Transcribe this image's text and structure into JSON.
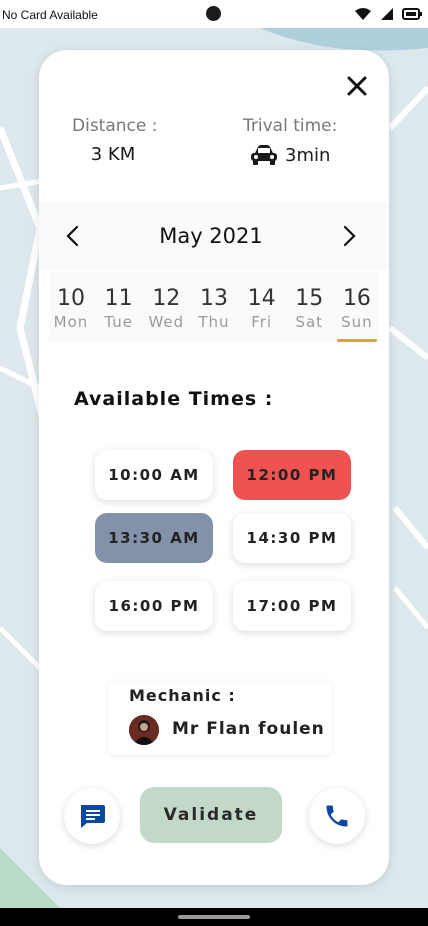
{
  "status_bar": {
    "carrier": "No Card Available"
  },
  "header": {
    "distance_label": "Distance :",
    "distance_value": "3 KM",
    "travel_label": "Trival time:",
    "travel_value": "3min"
  },
  "calendar": {
    "month": "May 2021",
    "days": [
      {
        "num": "10",
        "name": "Mon"
      },
      {
        "num": "11",
        "name": "Tue"
      },
      {
        "num": "12",
        "name": "Wed"
      },
      {
        "num": "13",
        "name": "Thu"
      },
      {
        "num": "14",
        "name": "Fri"
      },
      {
        "num": "15",
        "name": "Sat"
      },
      {
        "num": "16",
        "name": "Sun"
      }
    ],
    "selected_day": "16"
  },
  "times": {
    "title": "Available Times :",
    "slots": [
      {
        "label": "10:00 AM",
        "state": "default"
      },
      {
        "label": "12:00 PM",
        "state": "selected"
      },
      {
        "label": "13:30 AM",
        "state": "unavailable"
      },
      {
        "label": "14:30 PM",
        "state": "default"
      },
      {
        "label": "16:00 PM",
        "state": "default"
      },
      {
        "label": "17:00 PM",
        "state": "default"
      }
    ]
  },
  "mechanic": {
    "title": "Mechanic :",
    "name": "Mr Flan foulen"
  },
  "actions": {
    "validate_label": "Validate"
  },
  "colors": {
    "selected_slot": "#f05252",
    "unavailable_slot": "#8392a8",
    "validate_bg": "#c3d9c8",
    "accent_underline": "#f0a01e",
    "icon_blue": "#0d47a1"
  }
}
